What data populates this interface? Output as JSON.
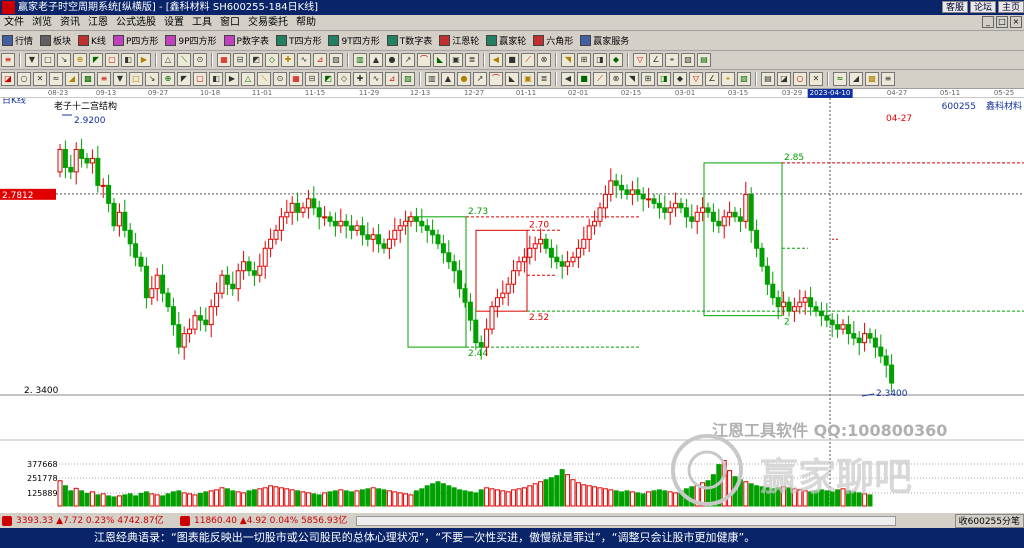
{
  "window": {
    "title": "赢家老子时空周期系统[纵横版] - [鑫科材料  SH600255-184日K线]",
    "buttons": [
      "客服",
      "论坛",
      "主页"
    ],
    "controls": [
      "_",
      "□",
      "×"
    ]
  },
  "menu": [
    "文件",
    "浏览",
    "资讯",
    "江恩",
    "公式选股",
    "设置",
    "工具",
    "窗口",
    "交易委托",
    "帮助"
  ],
  "toolbar1": [
    {
      "label": "行情",
      "icon": "quote-table-icon",
      "color": "#4060a0"
    },
    {
      "label": "板块",
      "icon": "sector-icon",
      "color": "#606060"
    },
    {
      "label": "K线",
      "icon": "kline-icon",
      "color": "#c03030"
    },
    {
      "label": "P四方形",
      "icon": "p-square-icon",
      "color": "#c040c0"
    },
    {
      "label": "9P四方形",
      "icon": "9p-square-icon",
      "color": "#c040c0"
    },
    {
      "label": "P数字表",
      "icon": "p-number-table-icon",
      "color": "#c040c0"
    },
    {
      "label": "T四方形",
      "icon": "t-square-icon",
      "color": "#208060"
    },
    {
      "label": "9T四方形",
      "icon": "9t-square-icon",
      "color": "#208060"
    },
    {
      "label": "T数字表",
      "icon": "t-number-table-icon",
      "color": "#208060"
    },
    {
      "label": "江恩轮",
      "icon": "gann-wheel-icon",
      "color": "#c03030"
    },
    {
      "label": "赢家轮",
      "icon": "winner-wheel-icon",
      "color": "#208060"
    },
    {
      "label": "六角形",
      "icon": "hexagon-icon",
      "color": "#c03030"
    },
    {
      "label": "赢家服务",
      "icon": "service-icon",
      "color": "#4060a0"
    }
  ],
  "toolbar2_count": 41,
  "toolbar3_count": 54,
  "dates": [
    "08-23",
    "09-13",
    "09-27",
    "10-18",
    "11-01",
    "11-15",
    "11-29",
    "12-13",
    "12-27",
    "01-11",
    "02-01",
    "02-15",
    "03-01",
    "03-15",
    "03-29",
    "2023-04-10",
    "04-27",
    "05-11",
    "05-25"
  ],
  "chart_data": {
    "type": "candlestick",
    "symbol": "600255",
    "symbol_name": "鑫科材料",
    "period_label": "日K线",
    "title": "老子十二宫结构",
    "ylim": [
      2.3,
      2.95
    ],
    "price_labels": {
      "high": "2.9200",
      "low": "2.3400",
      "current": "2.7812",
      "left_low": "2. 3400",
      "future_date": "04-27"
    },
    "level_lines": [
      "2.85",
      "2.73",
      "2.70",
      "2.52",
      "2.44"
    ],
    "boxes": [
      {
        "color": "#00a000",
        "top": 2.73,
        "bottom": 2.44,
        "label_top": "2.73",
        "label_bottom": "2.44"
      },
      {
        "color": "#e00000",
        "top": 2.7,
        "bottom": 2.52,
        "label_top": "2.70",
        "label_bottom": "2.52"
      },
      {
        "color": "#00a000",
        "top": 2.85,
        "bottom": 2.51,
        "label_top": "2.85",
        "label_bottom": "2"
      }
    ],
    "volume_ticks": [
      "377668",
      "251778",
      "125889"
    ],
    "watermark": [
      "江恩工具软件  QQ:100800360",
      "赢家聊吧"
    ],
    "close": [
      2.88,
      2.84,
      2.83,
      2.88,
      2.86,
      2.85,
      2.86,
      2.8,
      2.8,
      2.76,
      2.71,
      2.74,
      2.7,
      2.67,
      2.64,
      2.62,
      2.55,
      2.57,
      2.6,
      2.56,
      2.53,
      2.49,
      2.44,
      2.47,
      2.48,
      2.51,
      2.5,
      2.49,
      2.53,
      2.56,
      2.6,
      2.58,
      2.57,
      2.61,
      2.63,
      2.61,
      2.6,
      2.62,
      2.66,
      2.68,
      2.7,
      2.73,
      2.74,
      2.76,
      2.74,
      2.75,
      2.77,
      2.75,
      2.73,
      2.73,
      2.72,
      2.71,
      2.72,
      2.71,
      2.7,
      2.71,
      2.69,
      2.68,
      2.69,
      2.67,
      2.66,
      2.68,
      2.7,
      2.71,
      2.72,
      2.73,
      2.72,
      2.71,
      2.7,
      2.69,
      2.67,
      2.65,
      2.63,
      2.61,
      2.57,
      2.54,
      2.5,
      2.45,
      2.44,
      2.48,
      2.53,
      2.55,
      2.56,
      2.58,
      2.61,
      2.63,
      2.64,
      2.66,
      2.67,
      2.68,
      2.66,
      2.64,
      2.63,
      2.62,
      2.63,
      2.64,
      2.66,
      2.68,
      2.71,
      2.72,
      2.75,
      2.78,
      2.81,
      2.8,
      2.79,
      2.78,
      2.79,
      2.78,
      2.77,
      2.77,
      2.76,
      2.75,
      2.74,
      2.75,
      2.76,
      2.75,
      2.73,
      2.72,
      2.74,
      2.75,
      2.74,
      2.72,
      2.71,
      2.73,
      2.74,
      2.73,
      2.72,
      2.78,
      2.7,
      2.66,
      2.62,
      2.58,
      2.55,
      2.53,
      2.54,
      2.52,
      2.53,
      2.54,
      2.55,
      2.53,
      2.52,
      2.51,
      2.5,
      2.49,
      2.48,
      2.49,
      2.47,
      2.46,
      2.45,
      2.47,
      2.46,
      2.44,
      2.42,
      2.4,
      2.36
    ],
    "volume": [
      0.5,
      0.4,
      0.3,
      0.35,
      0.3,
      0.25,
      0.28,
      0.22,
      0.24,
      0.2,
      0.18,
      0.2,
      0.22,
      0.24,
      0.2,
      0.25,
      0.28,
      0.24,
      0.22,
      0.2,
      0.24,
      0.28,
      0.3,
      0.26,
      0.24,
      0.22,
      0.25,
      0.28,
      0.3,
      0.32,
      0.36,
      0.34,
      0.3,
      0.28,
      0.26,
      0.3,
      0.32,
      0.34,
      0.36,
      0.4,
      0.38,
      0.36,
      0.34,
      0.32,
      0.3,
      0.28,
      0.26,
      0.24,
      0.22,
      0.26,
      0.28,
      0.3,
      0.32,
      0.3,
      0.28,
      0.3,
      0.32,
      0.34,
      0.36,
      0.34,
      0.32,
      0.3,
      0.28,
      0.26,
      0.24,
      0.22,
      0.3,
      0.34,
      0.4,
      0.44,
      0.48,
      0.44,
      0.4,
      0.36,
      0.32,
      0.3,
      0.28,
      0.26,
      0.32,
      0.36,
      0.34,
      0.32,
      0.3,
      0.28,
      0.32,
      0.34,
      0.36,
      0.4,
      0.44,
      0.48,
      0.52,
      0.56,
      0.6,
      0.72,
      0.62,
      0.52,
      0.46,
      0.42,
      0.4,
      0.38,
      0.36,
      0.34,
      0.32,
      0.3,
      0.28,
      0.3,
      0.28,
      0.26,
      0.24,
      0.28,
      0.3,
      0.32,
      0.3,
      0.28,
      0.26,
      0.3,
      0.34,
      0.38,
      0.42,
      0.46,
      0.5,
      0.62,
      0.82,
      0.9,
      0.7,
      0.58,
      0.52,
      0.48,
      0.44,
      0.4,
      0.38,
      0.36,
      0.34,
      0.36,
      0.38,
      0.36,
      0.34,
      0.32,
      0.3,
      0.28,
      0.3,
      0.32,
      0.3,
      0.28,
      0.32,
      0.34,
      0.3,
      0.28,
      0.26,
      0.24,
      0.22
    ]
  },
  "status": {
    "sh": "3393.33 ▲7.72 0.23% 4742.87亿",
    "sz": "11860.40 ▲4.92 0.04% 5856.93亿",
    "count": "收600255分笔"
  },
  "quote": "江恩经典语录：“图表能反映出一切股市或公司股民的总体心理状况”，“不要一次性买进，傲慢就是罪过”，“调整只会让股市更加健康”。"
}
